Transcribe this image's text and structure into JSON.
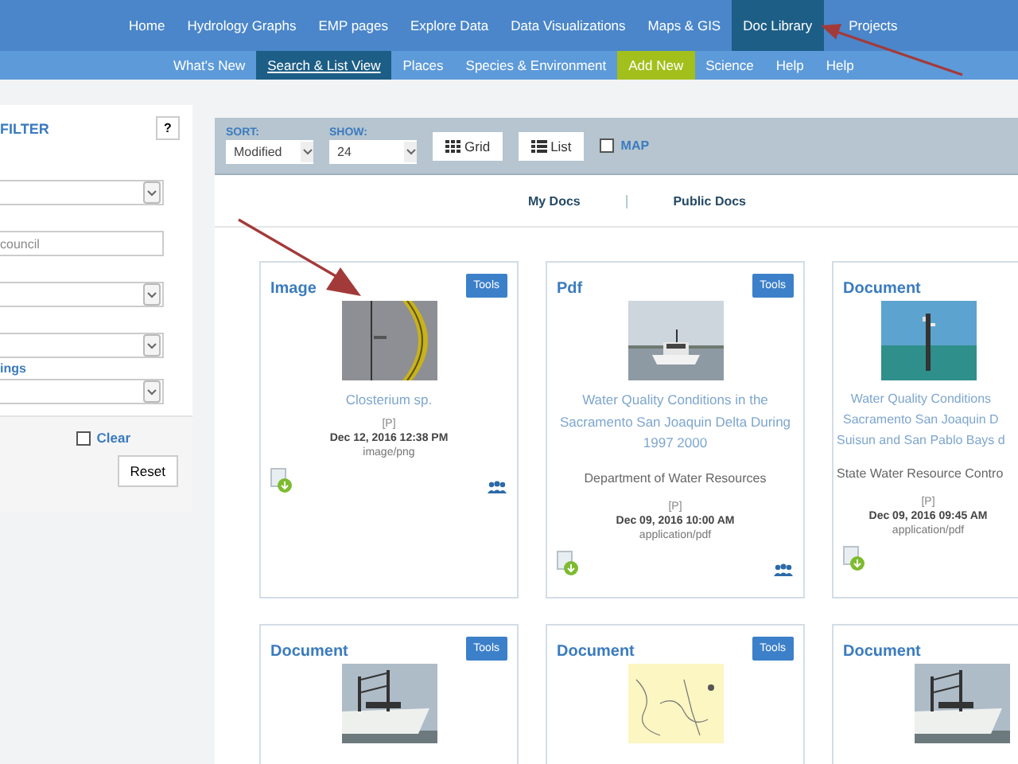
{
  "top_nav": [
    {
      "label": "Home",
      "selected": false
    },
    {
      "label": "Hydrology Graphs",
      "selected": false
    },
    {
      "label": "EMP pages",
      "selected": false
    },
    {
      "label": "Explore Data",
      "selected": false
    },
    {
      "label": "Data Visualizations",
      "selected": false
    },
    {
      "label": "Maps & GIS",
      "selected": false
    },
    {
      "label": "Doc Library",
      "selected": true
    },
    {
      "label": "Projects",
      "selected": false
    }
  ],
  "sub_nav": [
    {
      "label": "What's New",
      "selected": false,
      "kind": "link"
    },
    {
      "label": "Search & List View",
      "selected": true,
      "kind": "link"
    },
    {
      "label": "Places",
      "selected": false,
      "kind": "link"
    },
    {
      "label": "Species & Environment",
      "selected": false,
      "kind": "link"
    },
    {
      "label": "Add New",
      "selected": false,
      "kind": "add"
    },
    {
      "label": "Science",
      "selected": false,
      "kind": "link"
    },
    {
      "label": "Help",
      "selected": false,
      "kind": "link"
    },
    {
      "label": "Help",
      "selected": false,
      "kind": "link"
    }
  ],
  "filter": {
    "title": "FILTER",
    "help": "?",
    "fields": [
      {
        "kind": "select"
      },
      {
        "kind": "text",
        "value": "council"
      },
      {
        "kind": "select"
      },
      {
        "kind": "select"
      },
      {
        "kind": "label",
        "text": "ings"
      },
      {
        "kind": "select"
      }
    ],
    "clear": {
      "label": "Clear",
      "checked": false
    },
    "reset": "Reset"
  },
  "toolbar": {
    "sort_label": "SORT:",
    "sort": "Modified",
    "show_label": "SHOW:",
    "show": "24",
    "views": [
      {
        "label": "Grid",
        "kind": "grid"
      },
      {
        "label": "List",
        "kind": "list"
      }
    ],
    "map": {
      "label": "MAP",
      "checked": false
    }
  },
  "doc_tabs": {
    "items": [
      "My Docs",
      "Public Docs"
    ],
    "separator": "|"
  },
  "cards": [
    {
      "type": "Image",
      "tools": "Tools",
      "title": "Closterium sp.",
      "flag": "[P]",
      "date": "Dec 12, 2016 12:38 PM",
      "mime": "image/png",
      "shared": true
    },
    {
      "type": "Pdf",
      "tools": "Tools",
      "title": "Water Quality Conditions in the\nSacramento San Joaquin Delta During\n1997 2000",
      "agency": "Department of Water Resources",
      "flag": "[P]",
      "date": "Dec 09, 2016 10:00 AM",
      "mime": "application/pdf",
      "shared": true
    },
    {
      "type": "Document",
      "title": "Water Quality Conditions\nSacramento San Joaquin D\nSuisun and San Pablo Bays d",
      "agency": "State Water Resource Contro",
      "flag": "[P]",
      "date": "Dec 09, 2016 09:45 AM",
      "mime": "application/pdf",
      "shared": false
    },
    {
      "type": "Document",
      "tools": "Tools"
    },
    {
      "type": "Document",
      "tools": "Tools"
    },
    {
      "type": "Document"
    }
  ]
}
